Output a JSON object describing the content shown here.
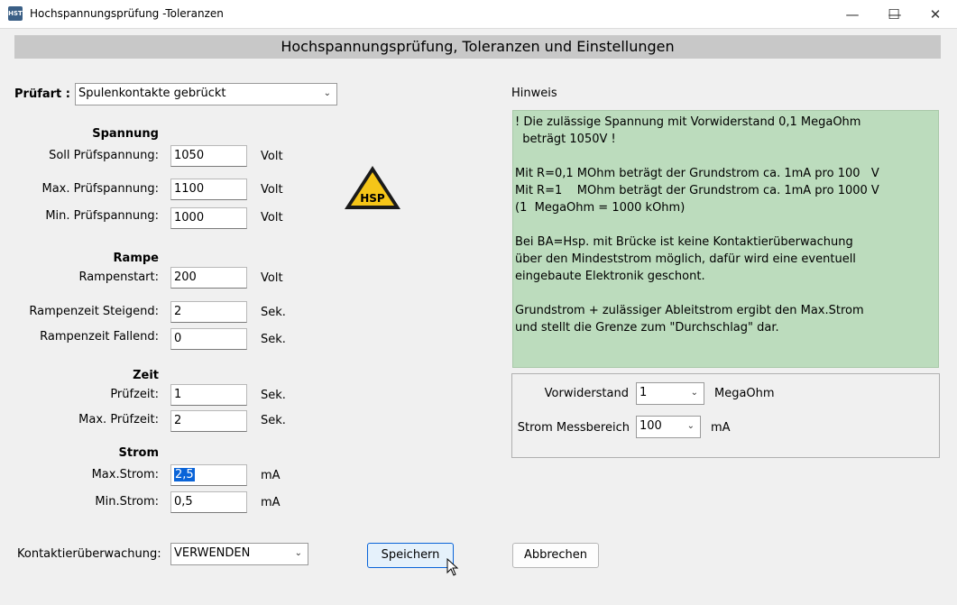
{
  "window": {
    "title": "Hochspannungsprüfung -Toleranzen",
    "icon_text": "HST",
    "minimize": "—",
    "maximize": "☐",
    "close": "✕"
  },
  "header": "Hochspannungsprüfung, Toleranzen und Einstellungen",
  "prufart": {
    "label": "Prüfart :",
    "value": "Spulenkontakte gebrückt"
  },
  "spannung": {
    "title": "Spannung",
    "soll_label": "Soll Prüfspannung:",
    "soll_value": "1050",
    "soll_unit": "Volt",
    "max_label": "Max. Prüfspannung:",
    "max_value": "1100",
    "max_unit": "Volt",
    "min_label": "Min. Prüfspannung:",
    "min_value": "1000",
    "min_unit": "Volt"
  },
  "rampe": {
    "title": "Rampe",
    "start_label": "Rampenstart:",
    "start_value": "200",
    "start_unit": "Volt",
    "steigend_label": "Rampenzeit Steigend:",
    "steigend_value": "2",
    "steigend_unit": "Sek.",
    "fallend_label": "Rampenzeit Fallend:",
    "fallend_value": "0",
    "fallend_unit": "Sek."
  },
  "zeit": {
    "title": "Zeit",
    "pruef_label": "Prüfzeit:",
    "pruef_value": "1",
    "pruef_unit": "Sek.",
    "max_label": "Max. Prüfzeit:",
    "max_value": "2",
    "max_unit": "Sek."
  },
  "strom": {
    "title": "Strom",
    "max_label": "Max.Strom:",
    "max_value": "2,5",
    "max_unit": "mA",
    "min_label": "Min.Strom:",
    "min_value": "0,5",
    "min_unit": "mA"
  },
  "hsp_sign": "HSP",
  "hinweis": {
    "label": "Hinweis",
    "lines": [
      "! Die zulässige Spannung mit Vorwiderstand 0,1 MegaOhm",
      "  beträgt 1050V !",
      "",
      "Mit R=0,1 MOhm beträgt der Grundstrom ca. 1mA pro 100   V",
      "Mit R=1    MOhm beträgt der Grundstrom ca. 1mA pro 1000 V",
      "(1  MegaOhm = 1000 kOhm)",
      "",
      "Bei BA=Hsp. mit Brücke ist keine Kontaktierüberwachung",
      "über den Mindeststrom möglich, dafür wird eine eventuell",
      "eingebaute Elektronik geschont.",
      "",
      "Grundstrom + zulässiger Ableitstrom ergibt den Max.Strom",
      "und stellt die Grenze zum \"Durchschlag\" dar."
    ]
  },
  "vorwiderstand": {
    "label": "Vorwiderstand",
    "value": "1",
    "unit": "MegaOhm"
  },
  "messbereich": {
    "label": "Strom Messbereich",
    "value": "100",
    "unit": "mA"
  },
  "kontakt": {
    "label": "Kontaktierüberwachung:",
    "value": "VERWENDEN"
  },
  "buttons": {
    "save": "Speichern",
    "cancel": "Abbrechen"
  },
  "colors": {
    "hint_bg": "#bcdcbd",
    "sign_yellow": "#f5c518",
    "selection": "#0a64d8"
  }
}
